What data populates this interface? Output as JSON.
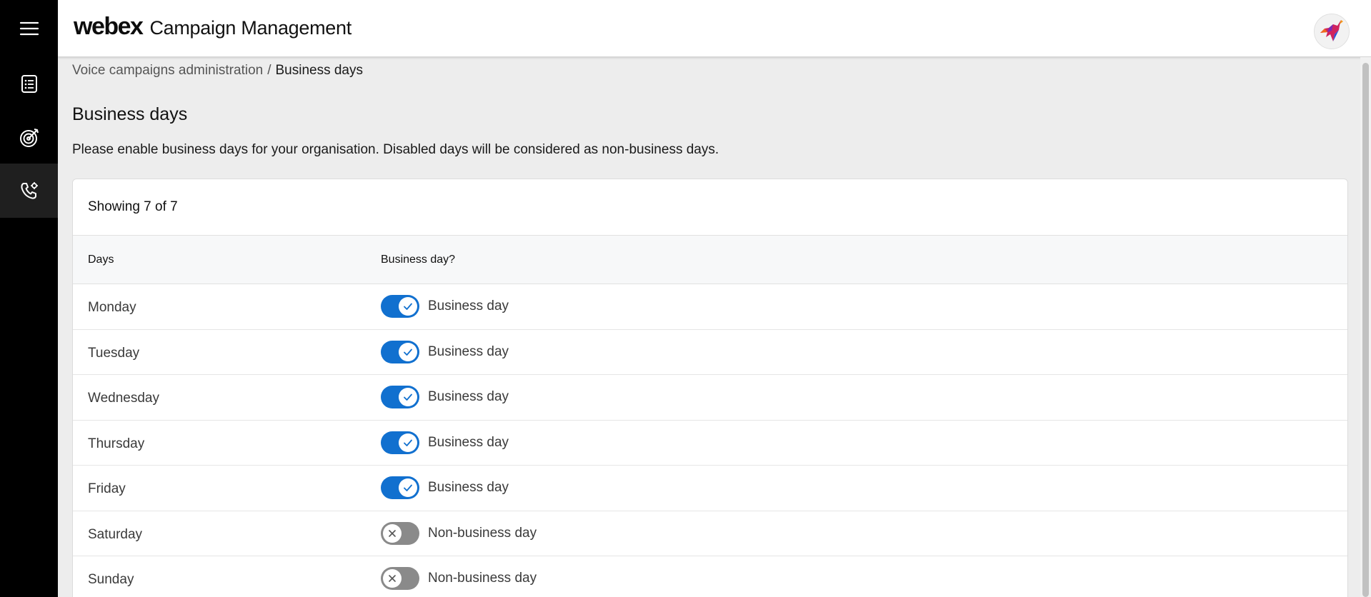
{
  "header": {
    "brand": "webex",
    "title": "Campaign Management"
  },
  "sidebar": {
    "items": [
      {
        "icon": "hamburger-menu-icon"
      },
      {
        "icon": "list-document-icon"
      },
      {
        "icon": "target-icon"
      },
      {
        "icon": "phone-settings-icon",
        "active": true
      }
    ]
  },
  "breadcrumb": {
    "parent": "Voice campaigns administration",
    "separator": "/",
    "current": "Business days"
  },
  "page": {
    "title": "Business days",
    "description": "Please enable business days for your organisation. Disabled days will be considered as non-business days."
  },
  "table": {
    "summary": "Showing 7 of 7",
    "columns": [
      "Days",
      "Business day?"
    ],
    "rows": [
      {
        "day": "Monday",
        "enabled": true,
        "label": "Business day"
      },
      {
        "day": "Tuesday",
        "enabled": true,
        "label": "Business day"
      },
      {
        "day": "Wednesday",
        "enabled": true,
        "label": "Business day"
      },
      {
        "day": "Thursday",
        "enabled": true,
        "label": "Business day"
      },
      {
        "day": "Friday",
        "enabled": true,
        "label": "Business day"
      },
      {
        "day": "Saturday",
        "enabled": false,
        "label": "Non-business day"
      },
      {
        "day": "Sunday",
        "enabled": false,
        "label": "Non-business day"
      }
    ]
  },
  "colors": {
    "toggle_on": "#1170cf",
    "toggle_off": "#8a8a8a",
    "sidebar_bg": "#000000"
  }
}
